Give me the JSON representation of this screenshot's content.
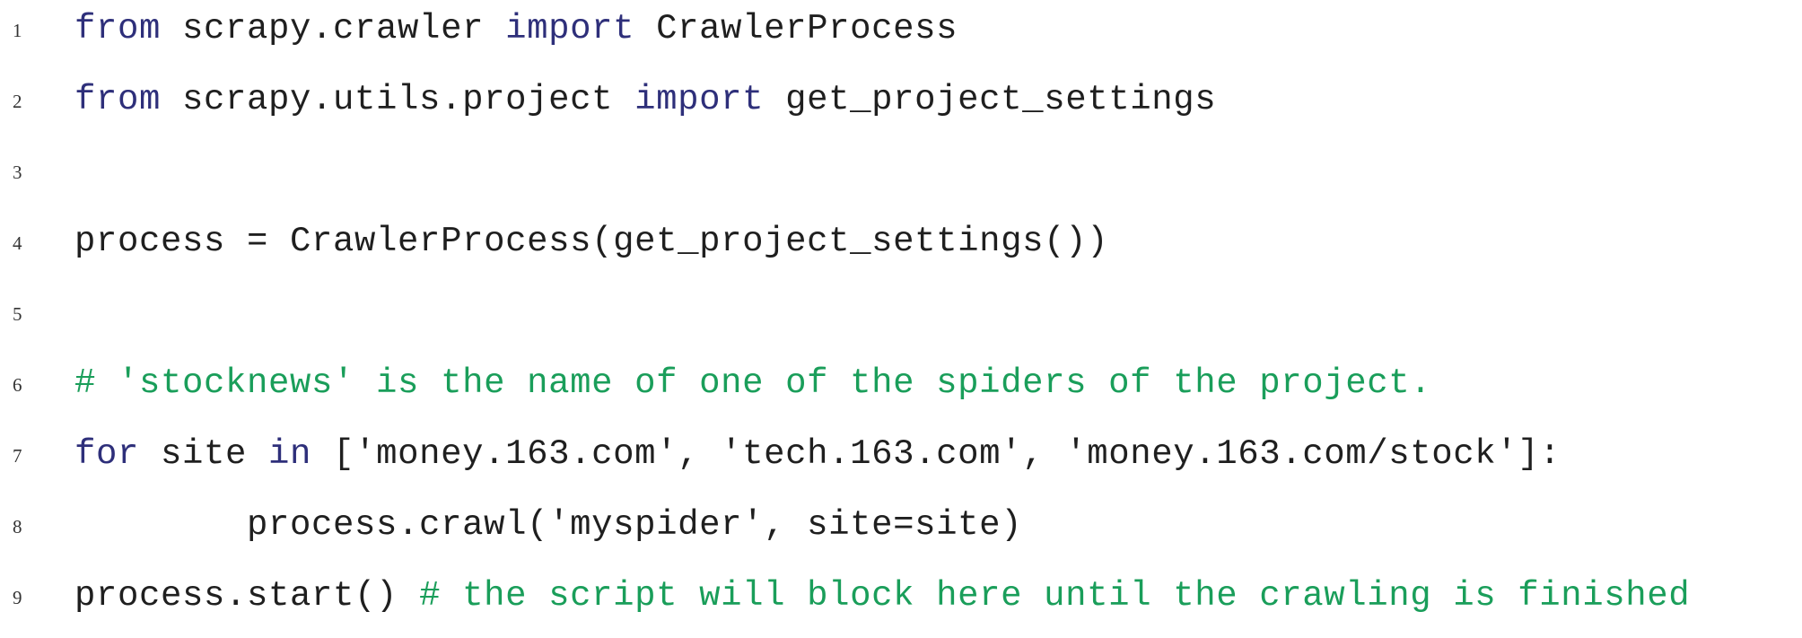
{
  "colors": {
    "keyword": "#2e2f7a",
    "comment": "#1a9e5a",
    "text": "#1f1f1f",
    "line_number": "#333333",
    "background": "#ffffff"
  },
  "code": {
    "language": "python",
    "lines": [
      {
        "number": "1",
        "tokens": [
          {
            "type": "kw",
            "text": "from"
          },
          {
            "type": "tx",
            "text": " scrapy.crawler "
          },
          {
            "type": "kw",
            "text": "import"
          },
          {
            "type": "tx",
            "text": " CrawlerProcess"
          }
        ]
      },
      {
        "number": "2",
        "tokens": [
          {
            "type": "kw",
            "text": "from"
          },
          {
            "type": "tx",
            "text": " scrapy.utils.project "
          },
          {
            "type": "kw",
            "text": "import"
          },
          {
            "type": "tx",
            "text": " get_project_settings"
          }
        ]
      },
      {
        "number": "3",
        "tokens": []
      },
      {
        "number": "4",
        "tokens": [
          {
            "type": "tx",
            "text": "process = CrawlerProcess(get_project_settings())"
          }
        ]
      },
      {
        "number": "5",
        "tokens": []
      },
      {
        "number": "6",
        "tokens": [
          {
            "type": "cm",
            "text": "# 'stocknews' is the name of one of the spiders of the project."
          }
        ]
      },
      {
        "number": "7",
        "tokens": [
          {
            "type": "kw",
            "text": "for"
          },
          {
            "type": "tx",
            "text": " site "
          },
          {
            "type": "kw",
            "text": "in"
          },
          {
            "type": "tx",
            "text": " ['money.163.com', 'tech.163.com', 'money.163.com/stock']:"
          }
        ]
      },
      {
        "number": "8",
        "tokens": [
          {
            "type": "tx",
            "text": "        process.crawl('myspider', site=site)"
          }
        ]
      },
      {
        "number": "9",
        "tokens": [
          {
            "type": "tx",
            "text": "process.start() "
          },
          {
            "type": "cm",
            "text": "# the script will block here until the crawling is finished"
          }
        ]
      }
    ]
  }
}
